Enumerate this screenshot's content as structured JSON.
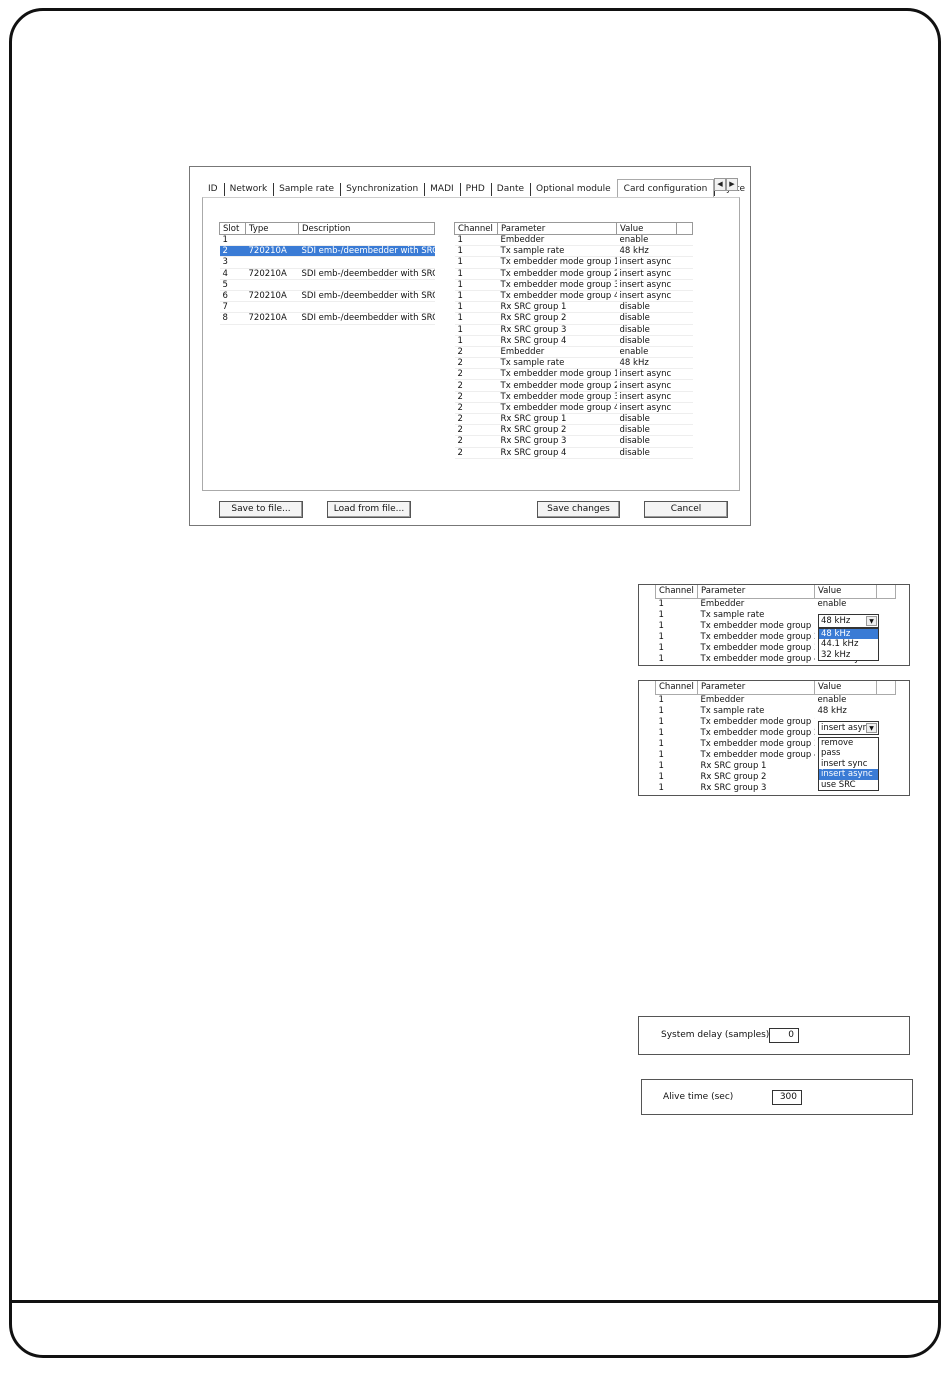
{
  "dialog": {
    "tabs": [
      "ID",
      "Network",
      "Sample rate",
      "Synchronization",
      "MADI",
      "PHD",
      "Dante",
      "Optional module",
      "Card configuration",
      "Syste"
    ],
    "active_tab": "Card configuration",
    "tab_scroll": {
      "left": "◀",
      "right": "▶"
    },
    "slot_table": {
      "headers": [
        "Slot",
        "Type",
        "Description"
      ],
      "rows": [
        [
          "1",
          "",
          ""
        ],
        [
          "2",
          "720210A",
          "SDI emb-/deembedder with SRC"
        ],
        [
          "3",
          "",
          ""
        ],
        [
          "4",
          "720210A",
          "SDI emb-/deembedder with SRC"
        ],
        [
          "5",
          "",
          ""
        ],
        [
          "6",
          "720210A",
          "SDI emb-/deembedder with SRC"
        ],
        [
          "7",
          "",
          ""
        ],
        [
          "8",
          "720210A",
          "SDI emb-/deembedder with SRC"
        ]
      ],
      "selected_row": 1
    },
    "param_table": {
      "headers": [
        "Channel",
        "Parameter",
        "Value"
      ],
      "rows": [
        [
          "1",
          "Embedder",
          "enable"
        ],
        [
          "1",
          "Tx sample rate",
          "48 kHz"
        ],
        [
          "1",
          "Tx embedder mode group 1",
          "insert async"
        ],
        [
          "1",
          "Tx embedder mode group 2",
          "insert async"
        ],
        [
          "1",
          "Tx embedder mode group 3",
          "insert async"
        ],
        [
          "1",
          "Tx embedder mode group 4",
          "insert async"
        ],
        [
          "1",
          "Rx SRC group 1",
          "disable"
        ],
        [
          "1",
          "Rx SRC group 2",
          "disable"
        ],
        [
          "1",
          "Rx SRC group 3",
          "disable"
        ],
        [
          "1",
          "Rx SRC group 4",
          "disable"
        ],
        [
          "2",
          "Embedder",
          "enable"
        ],
        [
          "2",
          "Tx sample rate",
          "48 kHz"
        ],
        [
          "2",
          "Tx embedder mode group 1",
          "insert async"
        ],
        [
          "2",
          "Tx embedder mode group 2",
          "insert async"
        ],
        [
          "2",
          "Tx embedder mode group 3",
          "insert async"
        ],
        [
          "2",
          "Tx embedder mode group 4",
          "insert async"
        ],
        [
          "2",
          "Rx SRC group 1",
          "disable"
        ],
        [
          "2",
          "Rx SRC group 2",
          "disable"
        ],
        [
          "2",
          "Rx SRC group 3",
          "disable"
        ],
        [
          "2",
          "Rx SRC group 4",
          "disable"
        ]
      ]
    },
    "buttons": {
      "save_to_file": "Save to file...",
      "load_from_file": "Load from file...",
      "save_changes": "Save changes",
      "cancel": "Cancel"
    }
  },
  "sample_rate_panel": {
    "headers": [
      "Channel",
      "Parameter",
      "Value"
    ],
    "rows": [
      [
        "1",
        "Embedder",
        "enable"
      ],
      [
        "1",
        "Tx sample rate",
        ""
      ],
      [
        "1",
        "Tx embedder mode group 1",
        ""
      ],
      [
        "1",
        "Tx embedder mode group 2",
        ""
      ],
      [
        "1",
        "Tx embedder mode group 3",
        ""
      ],
      [
        "1",
        "Tx embedder mode group 4",
        "insert async"
      ]
    ],
    "combo_value": "48 kHz",
    "options": [
      "48 kHz",
      "44.1 kHz",
      "32 kHz"
    ],
    "selected_option": 0
  },
  "embedder_mode_panel": {
    "headers": [
      "Channel",
      "Parameter",
      "Value"
    ],
    "rows": [
      [
        "1",
        "Embedder",
        "enable"
      ],
      [
        "1",
        "Tx sample rate",
        "48 kHz"
      ],
      [
        "1",
        "Tx embedder mode group 1",
        ""
      ],
      [
        "1",
        "Tx embedder mode group 2",
        ""
      ],
      [
        "1",
        "Tx embedder mode group 3",
        ""
      ],
      [
        "1",
        "Tx embedder mode group 4",
        ""
      ],
      [
        "1",
        "Rx SRC group 1",
        ""
      ],
      [
        "1",
        "Rx SRC group 2",
        ""
      ],
      [
        "1",
        "Rx SRC group 3",
        "disable"
      ]
    ],
    "combo_value": "insert asyn",
    "options": [
      "remove",
      "pass",
      "insert sync",
      "insert async",
      "use SRC"
    ],
    "selected_option": 3
  },
  "system_delay": {
    "label": "System delay (samples)",
    "value": "0"
  },
  "alive_time": {
    "label": "Alive time (sec)",
    "value": "300"
  }
}
